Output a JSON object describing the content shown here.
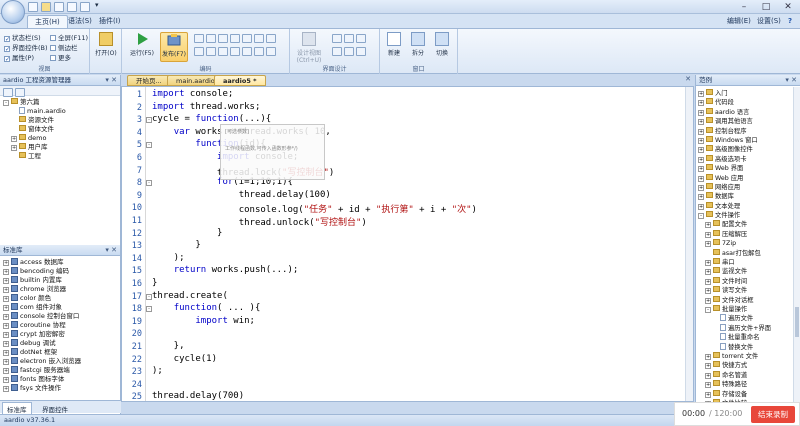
{
  "quick_access": {
    "dropdown": "▾"
  },
  "window": {
    "min": "–",
    "max": "□",
    "close": "✕"
  },
  "ribbon_tabs": [
    "主页(H)",
    "语法(S)",
    "插件(I)"
  ],
  "ribbon_right": {
    "encoding": "编辑(E)",
    "settings": "设置(S)",
    "help": "?"
  },
  "view_group": {
    "checks": [
      "状态栏(S)",
      "界面控件(B)",
      "属性(P)"
    ],
    "checks2": [
      "全屏(F11)",
      "侧边栏",
      "更多"
    ],
    "label": "视图"
  },
  "open_group": {
    "button": "打开(O)",
    "label": ""
  },
  "code_group": {
    "run": "运行(F5)",
    "publish": "发布(F7)",
    "label": "编码"
  },
  "ui_group": {
    "design": "设计视图",
    "design_sub": "(Ctrl+U)",
    "label": "界面设计"
  },
  "window_group": {
    "new": "新建",
    "split": "拆分",
    "switch": "切换",
    "label": "窗口"
  },
  "left_panel": {
    "title": "aardio 工程资源管理器",
    "pin": "▾ ✕",
    "tree": [
      {
        "label": "第六篇",
        "level": 0,
        "type": "folder",
        "toggle": "-"
      },
      {
        "label": "main.aardio",
        "level": 1,
        "type": "doc"
      },
      {
        "label": "资源文件",
        "level": 1,
        "type": "folder"
      },
      {
        "label": "窗体文件",
        "level": 1,
        "type": "folder"
      },
      {
        "label": "demo",
        "level": 1,
        "type": "folder",
        "toggle": "+"
      },
      {
        "label": "用户库",
        "level": 1,
        "type": "folder",
        "toggle": "+"
      },
      {
        "label": "工程",
        "level": 1,
        "type": "folder"
      }
    ]
  },
  "lib_panel": {
    "title": "标准库",
    "pin": "▾ ✕",
    "items": [
      "access 数据库",
      "bencoding 编码",
      "builtin 内置库",
      "chrome 浏览器",
      "color 颜色",
      "com 组件对象",
      "console 控制台窗口",
      "coroutine 协程",
      "crypt 加密解密",
      "debug 调试",
      "dotNet 框架",
      "electron 嵌入浏览器",
      "fastcgi 服务器端",
      "fonts 图标字体",
      "fsys 文件操作"
    ],
    "tabs": [
      "标准库",
      "界面控件"
    ]
  },
  "doc_tabs": [
    "开始页...",
    "main.aardio *",
    "aardio5 *"
  ],
  "editor": {
    "line_numbers": [
      "1",
      "2",
      "3",
      "4",
      "5",
      "6",
      "7",
      "8",
      "9",
      "10",
      "11",
      "12",
      "13",
      "14",
      "15",
      "16",
      "17",
      "18",
      "19",
      "20",
      "21",
      "22",
      "23",
      "24",
      "25"
    ],
    "lines": [
      "import console;",
      "import thread.works;",
      "cycle = function(...){",
      "    var works = thread.works( 10,",
      "        function(id){",
      "            import console;",
      "            thread.lock(\"写控制台\")",
      "            for(i=1;10;1){",
      "                thread.delay(100)",
      "                console.log(\"任务\" + id + \"执行第\" + i + \"次\")",
      "                thread.unlock(\"写控制台\")",
      "            }",
      "        }",
      "    );",
      "    return works.push(...);",
      "}",
      "thread.create(",
      "    function( ... ){",
      "        import win;",
      "",
      "    },",
      "    cycle(1)",
      ");",
      "",
      "thread.delay(700)"
    ],
    "autocomplete": [
      "[可选参数]",
      "工作线程函数,可传入函数形参*/)"
    ]
  },
  "right_panel": {
    "title": "范例",
    "pin": "▾ ✕",
    "items": [
      {
        "label": "入门",
        "level": 1,
        "toggle": "+"
      },
      {
        "label": "代码段",
        "level": 1,
        "toggle": "+"
      },
      {
        "label": "aardio 语言",
        "level": 1,
        "toggle": "+"
      },
      {
        "label": "调用其他语言",
        "level": 1,
        "toggle": "+"
      },
      {
        "label": "控制台程序",
        "level": 1,
        "toggle": "+"
      },
      {
        "label": "Windows 窗口",
        "level": 1,
        "toggle": "+"
      },
      {
        "label": "高级图像控件",
        "level": 1,
        "toggle": "+"
      },
      {
        "label": "高级选项卡",
        "level": 1,
        "toggle": "+"
      },
      {
        "label": "Web 界面",
        "level": 1,
        "toggle": "+"
      },
      {
        "label": "Web 应用",
        "level": 1,
        "toggle": "+"
      },
      {
        "label": "网络应用",
        "level": 1,
        "toggle": "+"
      },
      {
        "label": "数据库",
        "level": 1,
        "toggle": "+"
      },
      {
        "label": "文本处理",
        "level": 1,
        "toggle": "+"
      },
      {
        "label": "文件操作",
        "level": 1,
        "toggle": "-"
      },
      {
        "label": "配置文件",
        "level": 2,
        "toggle": "+"
      },
      {
        "label": "压缩解压",
        "level": 2,
        "toggle": "+"
      },
      {
        "label": "7Zip",
        "level": 2,
        "toggle": "+"
      },
      {
        "label": "asar打包解包",
        "level": 2,
        "toggle": ""
      },
      {
        "label": "串口",
        "level": 2,
        "toggle": "+"
      },
      {
        "label": "监视文件",
        "level": 2,
        "toggle": "+"
      },
      {
        "label": "文件时间",
        "level": 2,
        "toggle": "+"
      },
      {
        "label": "读写文件",
        "level": 2,
        "toggle": "+"
      },
      {
        "label": "文件对话框",
        "level": 2,
        "toggle": "+"
      },
      {
        "label": "批量操作",
        "level": 2,
        "toggle": "-"
      },
      {
        "label": "遍历文件",
        "level": 3,
        "toggle": ""
      },
      {
        "label": "遍历文件+界面",
        "level": 3,
        "toggle": ""
      },
      {
        "label": "批量重命名",
        "level": 3,
        "toggle": ""
      },
      {
        "label": "替换文件",
        "level": 3,
        "toggle": ""
      },
      {
        "label": "torrent 文件",
        "level": 2,
        "toggle": "+"
      },
      {
        "label": "快捷方式",
        "level": 2,
        "toggle": "+"
      },
      {
        "label": "命名管道",
        "level": 2,
        "toggle": "+"
      },
      {
        "label": "特殊路径",
        "level": 2,
        "toggle": "+"
      },
      {
        "label": "存储设备",
        "level": 2,
        "toggle": "+"
      },
      {
        "label": "文件比较",
        "level": 2,
        "toggle": "+"
      }
    ]
  },
  "statusbar": {
    "text": "aardio v37.36.1"
  },
  "recorder": {
    "time": "00:00",
    "total": "/ 120:00",
    "stop": "结束录制"
  },
  "colors": {
    "accent": "#c9d9ee",
    "keyword": "#0000c8",
    "string": "#b01010",
    "record": "#e8473a"
  }
}
